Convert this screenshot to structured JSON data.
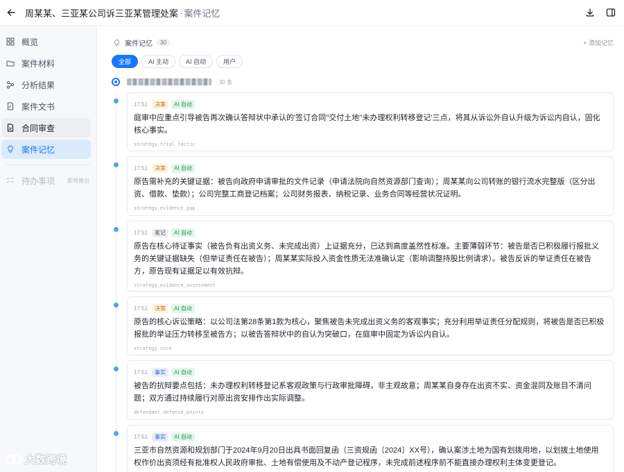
{
  "header": {
    "title": "周某某、三亚某公司诉三亚某管理处案",
    "separator": "·",
    "crumb": "案件记忆"
  },
  "sidebar": {
    "items": [
      {
        "label": "概览",
        "icon": "grid-icon"
      },
      {
        "label": "案件材料",
        "icon": "folder-icon"
      },
      {
        "label": "分析结果",
        "icon": "nodes-icon"
      },
      {
        "label": "案件文书",
        "icon": "doc-edit-icon"
      },
      {
        "label": "合同审查",
        "icon": "doc-check-icon"
      },
      {
        "label": "案件记忆",
        "icon": "bulb-icon"
      }
    ],
    "todo": {
      "label": "待办事项",
      "badge": "即将推出"
    }
  },
  "main": {
    "section_title": "案件记忆",
    "count": "30",
    "add_label": "+ 添加记忆",
    "filters": [
      "全部",
      "AI 主动",
      "AI 自动",
      "用户"
    ],
    "group_count": "· 30 条",
    "entries": [
      {
        "time": "17:51",
        "type": "决策",
        "source": "AI 自动",
        "text": "庭审中应重点引导被告再次确认答辩状中承认的'签订合同''交付土地''未办理权利转移登记'三点，将其从诉讼外自认升级为诉讼内自认，固化核心事实。",
        "key": "strategy.trial_tactic"
      },
      {
        "time": "17:51",
        "type": "决策",
        "source": "AI 自动",
        "text": "原告需补充的关键证据：被告向政府申请审批的文件记录（申请法院向自然资源部门查询）；周某某向公司转账的银行流水完整版（区分出资、借款、垫款）；公司完整工商登记档案；公司财务报表、纳税记录、业务合同等经营状况证明。",
        "key": "strategy.evidence_gap"
      },
      {
        "time": "17:51",
        "type": "笔记",
        "source": "AI 自动",
        "text": "原告在核心待证事实（被告负有出资义务、未完成出资）上证据充分，已达到高度盖然性标准。主要薄弱环节：被告是否已积极履行报批义务的关键证据缺失（但举证责任在被告）；周某某实际投入资金性质无法准确认定（影响调整持股比例请求）。被告反诉的举证责任在被告方，原告现有证据足以有效抗辩。",
        "key": "strategy.evidence_assessment"
      },
      {
        "time": "17:51",
        "type": "决策",
        "source": "AI 自动",
        "text": "原告的核心诉讼策略：以公司法第28条第1款为核心，聚焦被告未完成出资义务的客观事实；充分利用举证责任分配规则，将被告是否已积极报批的举证压力转移至被告方；以被告答辩状中的自认为突破口，在庭审中固定为诉讼内自认。",
        "key": "strategy.core"
      },
      {
        "time": "17:51",
        "type": "事实",
        "source": "AI 自动",
        "text": "被告的抗辩要点包括：未办理权利转移登记系客观政策与行政审批障碍，非主观故意；周某某自身存在出资不实、资金混同及账目不清问题；双方通过持续履行对原出资安排作出实际调整。",
        "key": "defendant.defense_points"
      },
      {
        "time": "17:51",
        "type": "事实",
        "source": "AI 自动",
        "text": "三亚市自然资源和规划部门于2024年9月20日出具书面回复函（三资规函〔2024〕XX号），确认案涉土地为国有划拨用地，以划拨土地使用权作价出资须经有批准权人民政府审批、土地有偿使用及不动产登记程序，未完成前述程序前不能直接办理权利主体变更登记。",
        "key": ""
      }
    ]
  },
  "watermark": "大数跨境"
}
